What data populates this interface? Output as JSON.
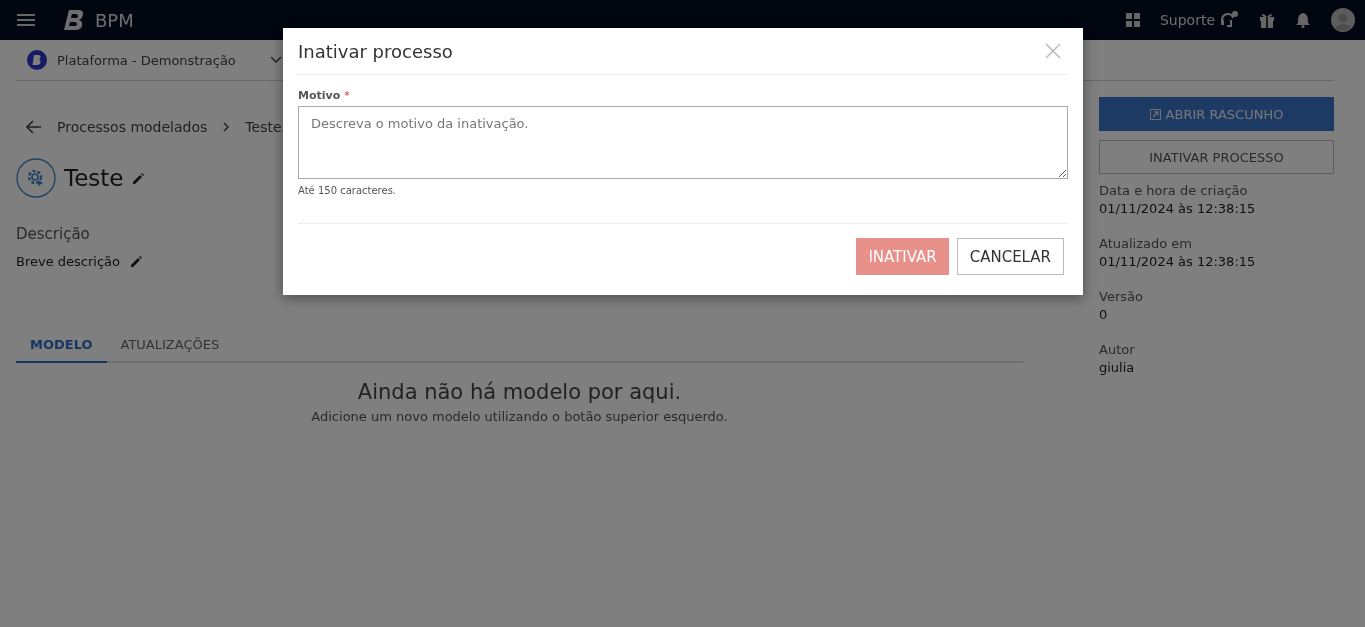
{
  "topbar": {
    "brand": "BPM",
    "support": "Suporte"
  },
  "workspace": {
    "name": "Plataforma - Demonstração"
  },
  "breadcrumb": [
    "Processos modelados",
    "Teste"
  ],
  "process": {
    "title": "Teste",
    "description_label": "Descrição",
    "description": "Breve descrição"
  },
  "tabs": [
    {
      "label": "MODELO",
      "selected": true
    },
    {
      "label": "ATUALIZAÇÕES",
      "selected": false
    }
  ],
  "empty_state": {
    "title": "Ainda não há modelo por aqui.",
    "hint": "Adicione um novo modelo utilizando o botão superior esquerdo."
  },
  "actions": [
    {
      "label": "ABRIR RASCUNHO",
      "kind": "primary"
    },
    {
      "label": "INATIVAR PROCESSO",
      "kind": "outline"
    }
  ],
  "details": [
    {
      "label": "Data e hora de criação",
      "value": "01/11/2024 às 12:38:15"
    },
    {
      "label": "Atualizado em",
      "value": "01/11/2024 às 12:38:15"
    },
    {
      "label": "Versão",
      "value": "0"
    },
    {
      "label": "Autor",
      "value": "giulia"
    }
  ],
  "modal": {
    "title": "Inativar processo",
    "field": {
      "label": "Motivo",
      "required": true,
      "required_mark": "*",
      "placeholder": "Descreva o motivo da inativação.",
      "hint": "Até 150 caracteres."
    },
    "buttons": [
      {
        "label": "INATIVAR",
        "kind": "danger",
        "disabled": true
      },
      {
        "label": "CANCELAR",
        "kind": "outline",
        "disabled": false
      }
    ]
  }
}
